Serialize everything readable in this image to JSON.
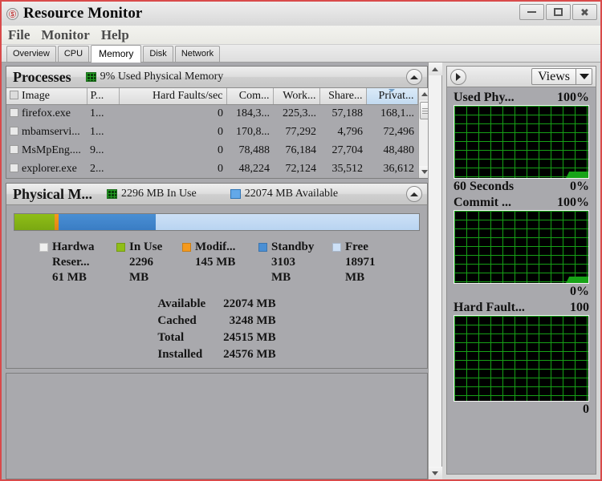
{
  "window": {
    "title": "Resource Monitor",
    "app_icon": "shield-icon",
    "minimize_label": "Minimize",
    "restore_label": "Restore",
    "close_label": "Close"
  },
  "menu": {
    "items": [
      "File",
      "Monitor",
      "Help"
    ]
  },
  "tabs": {
    "items": [
      "Overview",
      "CPU",
      "Memory",
      "Disk",
      "Network"
    ],
    "active": "Memory"
  },
  "processes_panel": {
    "title": "Processes",
    "status": "9% Used Physical Memory",
    "collapse_icon": "chevron-up-icon",
    "columns": [
      "Image",
      "P...",
      "Hard Faults/sec",
      "Com...",
      "Work...",
      "Share...",
      "Privat..."
    ],
    "sorted_column": "Privat...",
    "rows": [
      {
        "image": "firefox.exe",
        "pid": "1...",
        "hard_faults": "0",
        "commit": "184,3...",
        "working": "225,3...",
        "shareable": "57,188",
        "private": "168,1..."
      },
      {
        "image": "mbamservi...",
        "pid": "1...",
        "hard_faults": "0",
        "commit": "170,8...",
        "working": "77,292",
        "shareable": "4,796",
        "private": "72,496"
      },
      {
        "image": "MsMpEng....",
        "pid": "9...",
        "hard_faults": "0",
        "commit": "78,488",
        "working": "76,184",
        "shareable": "27,704",
        "private": "48,480"
      },
      {
        "image": "explorer.exe",
        "pid": "2...",
        "hard_faults": "0",
        "commit": "48,224",
        "working": "72,124",
        "shareable": "35,512",
        "private": "36,612"
      }
    ]
  },
  "physical_memory_panel": {
    "title": "Physical M...",
    "in_use_label": "2296 MB In Use",
    "available_label": "22074 MB Available",
    "collapse_icon": "chevron-up-icon",
    "legend": [
      {
        "name": "Hardwa",
        "value": "Reser...",
        "value2": "61 MB",
        "color": "#efefef"
      },
      {
        "name": "In Use",
        "value": "2296",
        "value2": "MB",
        "color": "#8fbe17"
      },
      {
        "name": "Modif...",
        "value": "145 MB",
        "value2": "",
        "color": "#f59a1e"
      },
      {
        "name": "Standby",
        "value": "3103",
        "value2": "MB",
        "color": "#4a8fd4"
      },
      {
        "name": "Free",
        "value": "18971",
        "value2": "MB",
        "color": "#cde0f6"
      }
    ],
    "bar_segments": [
      {
        "name": "In Use",
        "pct": 10.0,
        "color": "#8fbe17"
      },
      {
        "name": "Modified",
        "pct": 0.8,
        "color": "#f59a1e"
      },
      {
        "name": "Standby",
        "pct": 24.0,
        "color": "#4a8fd4"
      },
      {
        "name": "Free",
        "pct": 65.2,
        "color": "#cde0f6"
      }
    ],
    "stats": [
      {
        "key": "Available",
        "value": "22074 MB"
      },
      {
        "key": "Cached",
        "value": "3248 MB"
      },
      {
        "key": "Total",
        "value": "24515 MB"
      },
      {
        "key": "Installed",
        "value": "24576 MB"
      }
    ]
  },
  "sidebar": {
    "expand_icon": "chevron-right-icon",
    "views_label": "Views",
    "views_arrow_icon": "chevron-down-icon",
    "graphs": [
      {
        "title": "Used Phy...",
        "max": "100%",
        "foot_left": "60 Seconds",
        "foot_right": "0%",
        "has_trace": true
      },
      {
        "title": "Commit ...",
        "max": "100%",
        "foot_left": "",
        "foot_right": "0%",
        "has_trace": true
      },
      {
        "title": "Hard Fault...",
        "max": "100",
        "foot_left": "",
        "foot_right": "0",
        "has_trace": false
      }
    ]
  },
  "chart_data": [
    {
      "type": "area",
      "title": "Used Physical Memory",
      "ylabel": "%",
      "xlabel": "60 Seconds",
      "ylim": [
        0,
        100
      ],
      "ytick_top": "100%",
      "ytick_bottom": "0%",
      "current_value": 9,
      "grid": true,
      "series": [
        {
          "name": "Used Physical Memory",
          "values": [
            0,
            0,
            0,
            0,
            0,
            0,
            0,
            0,
            0,
            0,
            0,
            0,
            0,
            0,
            0,
            0,
            0,
            0,
            0,
            0,
            0,
            0,
            0,
            0,
            0,
            0,
            0,
            0,
            0,
            0,
            0,
            0,
            0,
            0,
            0,
            0,
            0,
            0,
            0,
            0,
            0,
            0,
            0,
            0,
            0,
            0,
            0,
            0,
            0,
            0,
            0,
            0,
            0,
            0,
            0,
            0,
            0,
            5,
            9,
            9
          ]
        }
      ]
    },
    {
      "type": "area",
      "title": "Commit Charge",
      "ylabel": "%",
      "xlabel": "",
      "ylim": [
        0,
        100
      ],
      "ytick_top": "100%",
      "ytick_bottom": "0%",
      "current_value": 9,
      "grid": true,
      "series": [
        {
          "name": "Commit Charge",
          "values": [
            0,
            0,
            0,
            0,
            0,
            0,
            0,
            0,
            0,
            0,
            0,
            0,
            0,
            0,
            0,
            0,
            0,
            0,
            0,
            0,
            0,
            0,
            0,
            0,
            0,
            0,
            0,
            0,
            0,
            0,
            0,
            0,
            0,
            0,
            0,
            0,
            0,
            0,
            0,
            0,
            0,
            0,
            0,
            0,
            0,
            0,
            0,
            0,
            0,
            0,
            0,
            0,
            0,
            0,
            0,
            0,
            0,
            5,
            9,
            9
          ]
        }
      ]
    },
    {
      "type": "area",
      "title": "Hard Faults/sec",
      "ylabel": "",
      "xlabel": "",
      "ylim": [
        0,
        100
      ],
      "ytick_top": "100",
      "ytick_bottom": "0",
      "current_value": 0,
      "grid": true,
      "series": [
        {
          "name": "Hard Faults/sec",
          "values": [
            0,
            0,
            0,
            0,
            0,
            0,
            0,
            0,
            0,
            0,
            0,
            0,
            0,
            0,
            0,
            0,
            0,
            0,
            0,
            0,
            0,
            0,
            0,
            0,
            0,
            0,
            0,
            0,
            0,
            0,
            0,
            0,
            0,
            0,
            0,
            0,
            0,
            0,
            0,
            0,
            0,
            0,
            0,
            0,
            0,
            0,
            0,
            0,
            0,
            0,
            0,
            0,
            0,
            0,
            0,
            0,
            0,
            0,
            0,
            0
          ]
        }
      ]
    },
    {
      "type": "bar",
      "title": "Physical Memory Distribution (MB)",
      "categories": [
        "Hardware Reserved",
        "In Use",
        "Modified",
        "Standby",
        "Free"
      ],
      "values": [
        61,
        2296,
        145,
        3103,
        18971
      ],
      "xlabel": "",
      "ylabel": "MB",
      "ylim": [
        0,
        24576
      ]
    }
  ]
}
